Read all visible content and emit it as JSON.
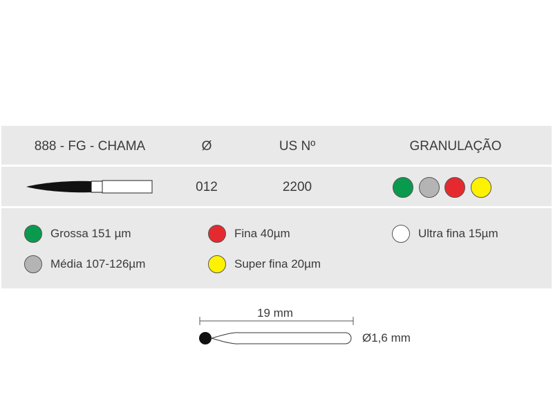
{
  "header": {
    "product": "888 - FG - CHAMA",
    "diameter": "Ø",
    "us_no": "US Nº",
    "granulation": "GRANULAÇÃO"
  },
  "row": {
    "diameter": "012",
    "us_no": "2200",
    "granulation_swatches": [
      {
        "name": "green",
        "color": "#0a9a4e"
      },
      {
        "name": "gray",
        "color": "#b4b4b4"
      },
      {
        "name": "red",
        "color": "#e52a2f"
      },
      {
        "name": "yellow",
        "color": "#fff200"
      }
    ]
  },
  "legend": {
    "items": [
      {
        "label": "Grossa 151 µm",
        "color": "#0a9a4e"
      },
      {
        "label": "Média 107-126µm",
        "color": "#b4b4b4"
      },
      {
        "label": "Fina 40µm",
        "color": "#e52a2f"
      },
      {
        "label": "Super fina 20µm",
        "color": "#fff200"
      },
      {
        "label": "Ultra fina 15µm",
        "color": "#ffffff"
      }
    ]
  },
  "dimensions": {
    "length": "19 mm",
    "diameter": "Ø1,6 mm"
  }
}
